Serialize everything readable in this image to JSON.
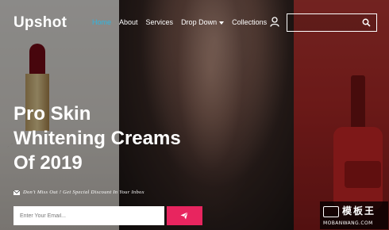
{
  "brand": {
    "name": "Upshot"
  },
  "nav": {
    "items": [
      {
        "label": "Home",
        "active": true
      },
      {
        "label": "About",
        "active": false
      },
      {
        "label": "Services",
        "active": false
      },
      {
        "label": "Drop Down",
        "active": false,
        "has_dropdown": true
      },
      {
        "label": "Collections",
        "active": false
      }
    ],
    "user_icon": "user-icon",
    "search": {
      "placeholder": "",
      "value": "",
      "icon": "search-icon"
    }
  },
  "hero": {
    "title_lines": [
      "Pro Skin",
      "Whitening Creams",
      "Of 2019"
    ],
    "promo_text": "Don't Miss Out ! Get Special Discount In Your Inbox",
    "promo_icon": "envelope-icon",
    "email": {
      "placeholder": "Enter Your Email...",
      "value": ""
    },
    "submit_icon": "paper-plane-icon"
  },
  "watermark": {
    "title": "模板王",
    "subtitle": "MOBANWANG.COM"
  },
  "colors": {
    "accent_active": "#2fb5e0",
    "button": "#e8255f",
    "text": "#ffffff"
  }
}
